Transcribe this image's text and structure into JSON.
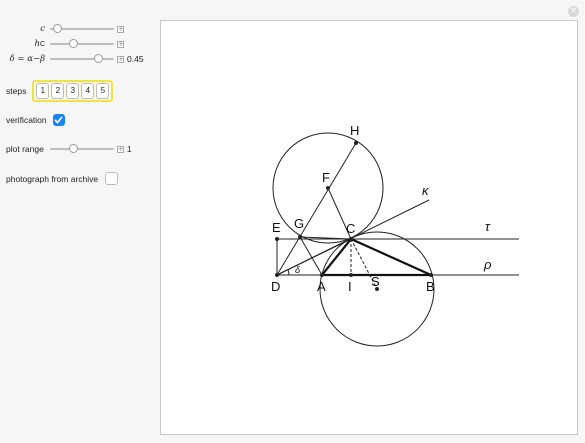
{
  "controls": {
    "c": {
      "label": "c",
      "position": 0.05
    },
    "hc": {
      "label_main": "h",
      "label_sub": "C",
      "position": 0.35
    },
    "delta": {
      "label": "δ = α−β",
      "value": "0.45",
      "position": 0.8
    },
    "steps": {
      "label": "steps",
      "options": [
        "1",
        "2",
        "3",
        "4",
        "5"
      ]
    },
    "verification": {
      "label": "verification",
      "checked": true
    },
    "plot_range": {
      "label": "plot range",
      "value": "1",
      "position": 0.35
    },
    "photo": {
      "label": "photograph from archive",
      "checked": false
    }
  },
  "diagram": {
    "points": {
      "H": "H",
      "F": "F",
      "E": "E",
      "G": "G",
      "C": "C",
      "D": "D",
      "A": "A",
      "I": "I",
      "S": "S",
      "B": "B"
    },
    "kappa": "κ",
    "tau": "τ",
    "rho": "ρ",
    "delta": "δ"
  },
  "close_symbol": "×"
}
